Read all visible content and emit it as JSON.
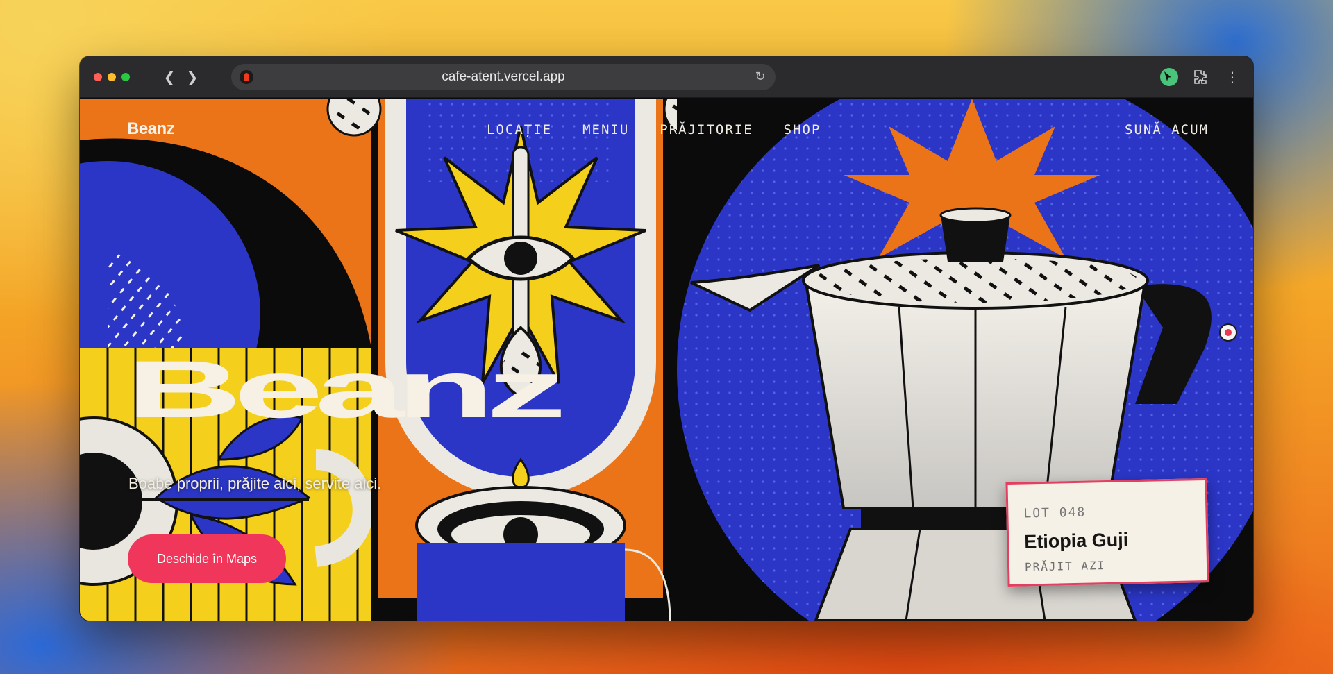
{
  "browser": {
    "url": "cafe-atent.vercel.app",
    "back_icon": "chevron-left",
    "forward_icon": "chevron-right",
    "reload_icon": "reload",
    "extensions_icon": "puzzle",
    "menu_icon": "vertical-dots"
  },
  "site": {
    "brand": "Beanz",
    "nav": [
      "LOCAȚIE",
      "MENIU",
      "PRĂJITORIE",
      "SHOP"
    ],
    "call_cta": "SUNĂ ACUM",
    "hero_title": "Beanz",
    "hero_subtitle": "Boabe proprii, prăjite aici, servite aici.",
    "maps_button": "Deschide în Maps",
    "lot_card": {
      "lot": "LOT 048",
      "name": "Etiopia Guji",
      "roast": "PRĂJIT AZI"
    }
  },
  "colors": {
    "accent": "#f0365a",
    "blue": "#2b36c6",
    "yellow": "#f4d01c",
    "orange": "#ec7418",
    "cream": "#f6f1e4"
  }
}
